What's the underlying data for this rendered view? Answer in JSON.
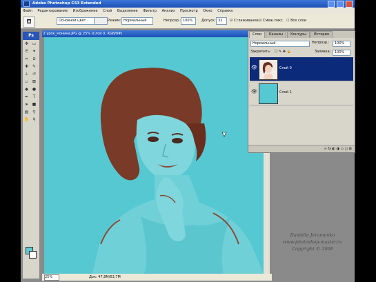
{
  "app": {
    "title": "Adobe Photoshop CS3 Extended"
  },
  "menu": [
    "Файл",
    "Редактирование",
    "Изображение",
    "Слой",
    "Выделение",
    "Фильтр",
    "Анализ",
    "Просмотр",
    "Окно",
    "Справка"
  ],
  "options": {
    "color_mode": "Основной цвет",
    "mode_label": "Режим:",
    "mode_value": "Нормальный",
    "opacity_label": "Непрозр.:",
    "opacity_value": "100%",
    "tolerance_label": "Допуск:",
    "tolerance_value": "32",
    "antialias": "Сглаживание",
    "contiguous": "Смеж.пикс.",
    "all_layers": "Все слои"
  },
  "toolbox": {
    "logo": "Ps"
  },
  "document": {
    "title": "2 урок_монина.JPG @ 25% (Слой 0, RGB/8#)",
    "zoom": "25%",
    "doc_info": "Док: 47,8M/63,7M",
    "bg_color": "#56c8d2"
  },
  "panel": {
    "tabs": [
      "Слои",
      "Каналы",
      "Контуры",
      "История"
    ],
    "blend_mode": "Нормальный",
    "opacity_label": "Непрозр.:",
    "opacity_value": "100%",
    "lock_label": "Закрепить:",
    "fill_label": "Заливка:",
    "fill_value": "100%",
    "layers": [
      {
        "name": "Слой 0",
        "selected": true
      },
      {
        "name": "Слой 1",
        "selected": false
      }
    ],
    "footer_icons": "∞ fx ◐ ◑ ▭ ◻ ☰"
  },
  "watermark": {
    "line1": "Danielle Jeramenko",
    "line2": "www.photoshop-master.ru",
    "line3": "Copyright © 2008"
  }
}
